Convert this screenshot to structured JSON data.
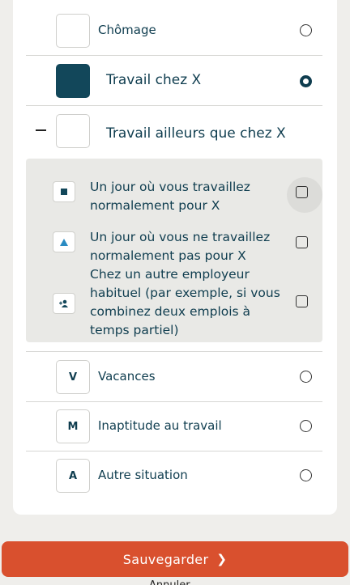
{
  "options": [
    {
      "label": "Chômage",
      "badge": "",
      "selected": false
    },
    {
      "label": "Travail chez  X",
      "badge": "",
      "selected": true
    },
    {
      "label": "Travail ailleurs que chez X",
      "badge": "",
      "selected": false,
      "expanded": true
    },
    {
      "label": "Vacances",
      "badge": "V",
      "selected": false
    },
    {
      "label": "Inaptitude au travail",
      "badge": "M",
      "selected": false
    },
    {
      "label": "Autre situation",
      "badge": "A",
      "selected": false
    }
  ],
  "sub_options": [
    {
      "label": "Un jour où vous travaillez normalement pour X",
      "icon": "square-icon"
    },
    {
      "label": "Un jour où vous ne travaillez normalement pas pour X",
      "icon": "triangle-icon"
    },
    {
      "label": "Chez un autre employeur habituel (par exemple, si vous combinez deux emplois à temps partiel)",
      "icon": "person-add-icon"
    }
  ],
  "save_button": {
    "label": "Sauvegarder"
  },
  "bottom_partial": "Annuler",
  "colors": {
    "accent": "#0f3d4f",
    "primary_button": "#d9502e",
    "background": "#efeeeb"
  }
}
